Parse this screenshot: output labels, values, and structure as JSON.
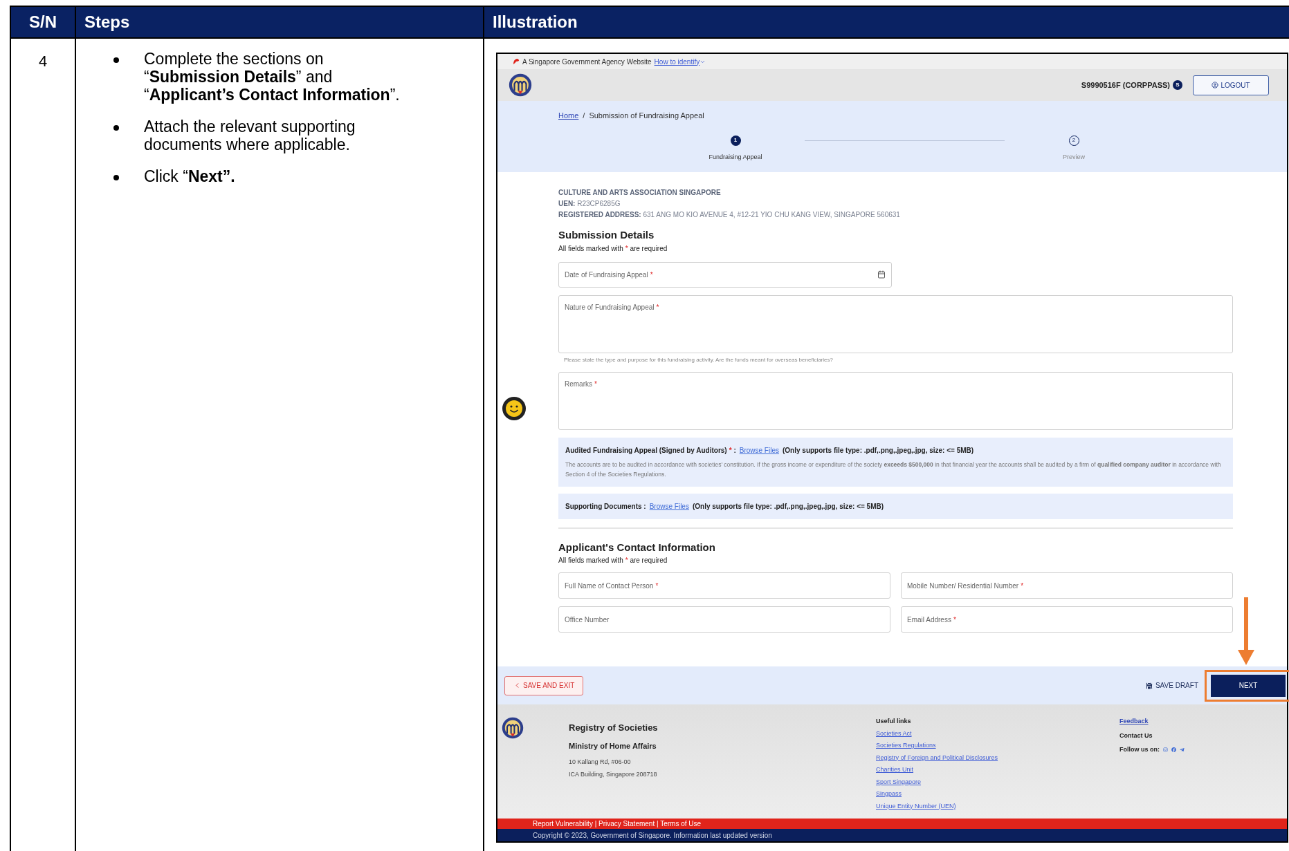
{
  "table": {
    "columns": [
      "S/N",
      "Steps",
      "Illustration"
    ],
    "rows": [
      {
        "sn": "4",
        "steps": [
          "Complete the sections on “**Submission Details**” and “**Applicant’s Contact Information**”.",
          "Attach the relevant supporting documents where applicable.",
          "Click “**Next”.**"
        ]
      }
    ]
  },
  "illustration": {
    "gov_banner": {
      "text": "A Singapore Government Agency Website",
      "link": "How to identify"
    },
    "header": {
      "user": "S9990516F (CORPPASS)",
      "badge": "S",
      "logout": "LOGOUT"
    },
    "breadcrumb": {
      "items": [
        "Home",
        "Submission of Fundraising Appeal"
      ],
      "separator": "/"
    },
    "stepper": [
      {
        "number": "1",
        "label": "Fundraising Appeal",
        "selected": true
      },
      {
        "number": "2",
        "label": "Preview",
        "selected": false
      }
    ],
    "organisation": {
      "name": "CULTURE AND ARTS ASSOCIATION SINGAPORE",
      "uen_label": "UEN:",
      "uen": "R23CP6285G",
      "address_label": "REGISTERED ADDRESS:",
      "address": "631 ANG MO KIO AVENUE 4, #12-21 YIO CHU KANG VIEW, SINGAPORE 560631"
    },
    "submission": {
      "title": "Submission Details",
      "note_before": "All fields marked with",
      "note_mark": "*",
      "note_after": "are required",
      "fields": [
        {
          "kind": "date",
          "label": "Date of Fundraising Appeal",
          "mark": "*"
        },
        {
          "kind": "textarea",
          "label": "Nature of Fundraising Appeal",
          "mark": "*",
          "helper": "Please state the type and purpose for this fundraising activity. Are the funds meant for overseas beneficiaries?"
        },
        {
          "kind": "textarea",
          "label": "Remarks",
          "mark": "*"
        }
      ],
      "uploads": [
        {
          "label": "Audited Fundraising Appeal (Signed by Auditors)",
          "mark": "*",
          "separator": ":",
          "link": "Browse Files",
          "info": "(Only supports file type: .pdf,.png,.jpeg,.jpg, size: <= 5MB)",
          "note": "The accounts are to be audited in accordance with societies' constitution. If the gross income or expenditure of the society **exceeds $500,000** in that financial year the accounts shall be audited by a firm of **qualified company auditor** in accordance with Section 4 of the Societies Regulations."
        },
        {
          "label": "Supporting Documents",
          "separator": ":",
          "link": "Browse Files",
          "info": "(Only supports file type: .pdf,.png,.jpeg,.jpg, size: <= 5MB)"
        }
      ]
    },
    "contact": {
      "title": "Applicant's Contact Information",
      "note_before": "All fields marked with",
      "note_mark": "*",
      "note_after": "are required",
      "fields": [
        {
          "label": "Full Name of Contact Person",
          "mark": "*"
        },
        {
          "label": "Mobile Number/ Residential Number",
          "mark": "*"
        },
        {
          "label": "Office Number"
        },
        {
          "label": "Email Address",
          "mark": "*"
        }
      ]
    },
    "actions": {
      "save_exit": "SAVE AND EXIT",
      "save_draft": "SAVE DRAFT",
      "next": "NEXT"
    },
    "footer": {
      "org": "Registry of Societies",
      "ministry": "Ministry of Home Affairs",
      "address": [
        "10 Kallang Rd, #06-00",
        "ICA Building, Singapore 208718"
      ],
      "links_title": "Useful links",
      "links": [
        "Societies Act",
        "Societies Regulations",
        "Registry of Foreign and Political Disclosures",
        "Charities Unit",
        "Sport Singapore",
        "Singpass",
        "Unique Entity Number (UEN)"
      ],
      "feedback": "Feedback",
      "contact": "Contact Us",
      "follow": "Follow us on:",
      "legal": "Report Vulnerability | Privacy Statement | Terms of Use",
      "copyright": "Copyright © 2023, Government of Singapore. Information last updated version"
    }
  }
}
